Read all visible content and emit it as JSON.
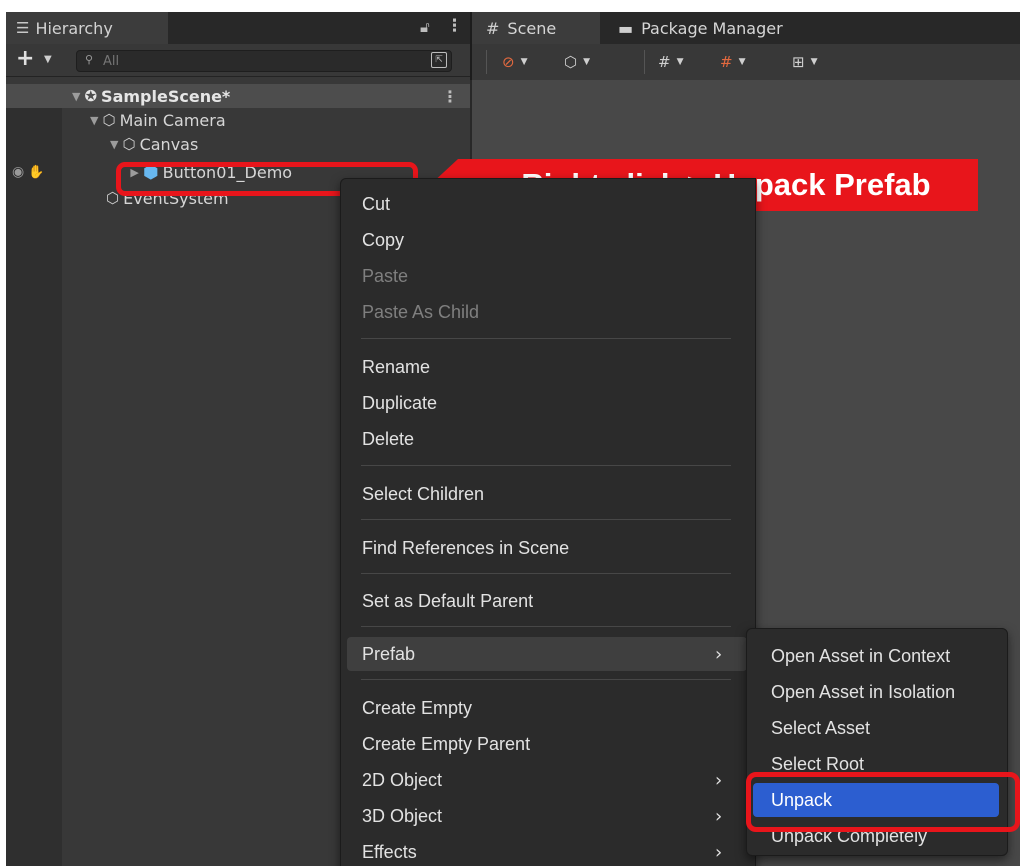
{
  "hierarchy": {
    "tab_icon": "list-tree-icon",
    "tab_label": "Hierarchy",
    "search_placeholder": "All",
    "items": [
      {
        "label": "SampleScene*",
        "icon": "unity-scene-icon"
      },
      {
        "label": "Main Camera",
        "icon": "gameobject-cube-icon"
      },
      {
        "label": "Canvas",
        "icon": "gameobject-cube-icon"
      },
      {
        "label": "Button01_Demo",
        "icon": "prefab-cube-icon"
      },
      {
        "label": "EventSystem",
        "icon": "gameobject-cube-icon"
      }
    ]
  },
  "scene": {
    "tabs": [
      {
        "label": "Scene",
        "icon": "hash-icon"
      },
      {
        "label": "Package Manager",
        "icon": "package-icon"
      }
    ]
  },
  "callout": {
    "text": "Right click > Unpack Prefab",
    "color": "#e8151b"
  },
  "context_menu": {
    "items": [
      {
        "label": "Cut",
        "enabled": true
      },
      {
        "label": "Copy",
        "enabled": true
      },
      {
        "label": "Paste",
        "enabled": false
      },
      {
        "label": "Paste As Child",
        "enabled": false
      },
      {
        "label": "Rename",
        "enabled": true
      },
      {
        "label": "Duplicate",
        "enabled": true
      },
      {
        "label": "Delete",
        "enabled": true
      },
      {
        "label": "Select Children",
        "enabled": true
      },
      {
        "label": "Find References in Scene",
        "enabled": true
      },
      {
        "label": "Set as Default Parent",
        "enabled": true
      },
      {
        "label": "Prefab",
        "enabled": true,
        "submenu": true,
        "active": true
      },
      {
        "label": "Create Empty",
        "enabled": true
      },
      {
        "label": "Create Empty Parent",
        "enabled": true
      },
      {
        "label": "2D Object",
        "enabled": true,
        "submenu": true
      },
      {
        "label": "3D Object",
        "enabled": true,
        "submenu": true
      },
      {
        "label": "Effects",
        "enabled": true,
        "submenu": true
      }
    ]
  },
  "prefab_submenu": {
    "items": [
      {
        "label": "Open Asset in Context"
      },
      {
        "label": "Open Asset in Isolation"
      },
      {
        "label": "Select Asset"
      },
      {
        "label": "Select Root"
      },
      {
        "label": "Unpack",
        "selected": true
      },
      {
        "label": "Unpack Completely"
      }
    ]
  },
  "colors": {
    "selection": "#2c5ed0",
    "panel": "#383838",
    "menu": "#2b2b2b",
    "highlight": "#e8151b"
  }
}
